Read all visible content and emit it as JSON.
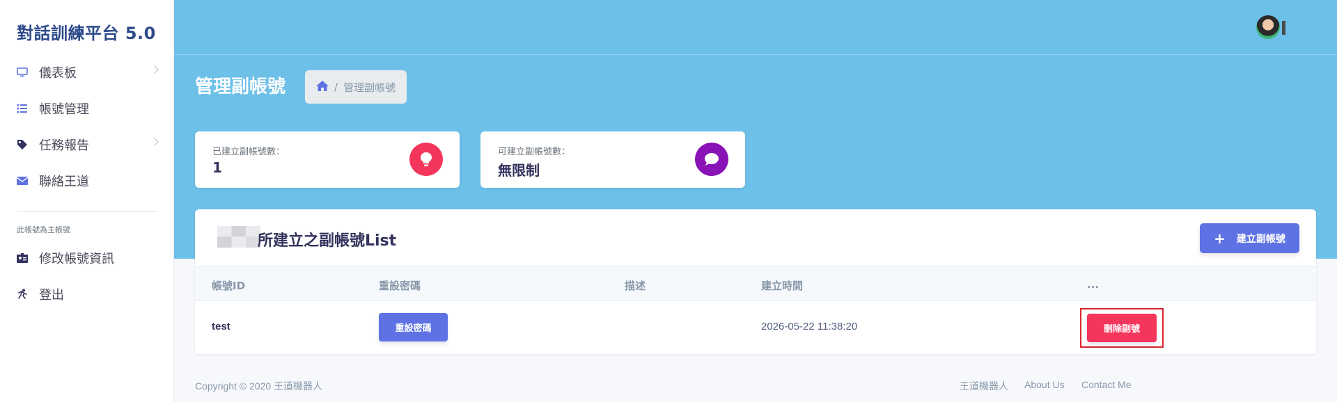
{
  "brand": "對話訓練平台 5.0",
  "sidebar": {
    "items": [
      {
        "label": "儀表板",
        "icon": "monitor-icon",
        "has_children": true
      },
      {
        "label": "帳號管理",
        "icon": "list-icon",
        "has_children": false
      },
      {
        "label": "任務報告",
        "icon": "tag-icon",
        "has_children": true
      },
      {
        "label": "聯絡王道",
        "icon": "envelope-icon",
        "has_children": false
      }
    ],
    "section_label": "此帳號為主帳號",
    "account_items": [
      {
        "label": "修改帳號資訊",
        "icon": "id-card-icon"
      },
      {
        "label": "登出",
        "icon": "running-man-icon"
      }
    ]
  },
  "header": {
    "page_title": "管理副帳號",
    "breadcrumb_current": "管理副帳號"
  },
  "stats": [
    {
      "label": "已建立副帳號數：",
      "value": "1",
      "color": "#f5365c"
    },
    {
      "label": "可建立副帳號數：",
      "value": "無限制",
      "color": "#8913b7"
    }
  ],
  "table": {
    "title": "所建立之副帳號List",
    "create_button": "建立副帳號",
    "columns": [
      "帳號ID",
      "重設密碼",
      "描述",
      "建立時間",
      "..."
    ],
    "rows": [
      {
        "id": "test",
        "reset_label": "重設密碼",
        "description": "",
        "created": "2026-05-22 11:38:20",
        "delete_label": "刪除副號"
      }
    ]
  },
  "footer": {
    "copyright": "Copyright © 2020 王道機器人",
    "links": [
      "王道機器人",
      "About Us",
      "Contact Me"
    ]
  }
}
